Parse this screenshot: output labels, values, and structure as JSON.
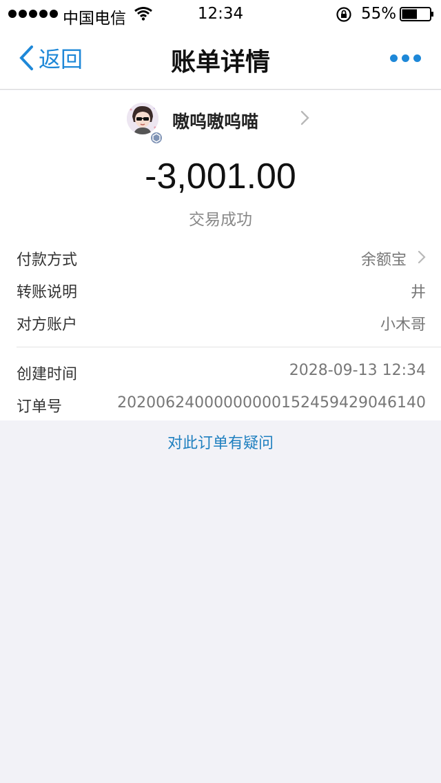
{
  "status_bar": {
    "carrier": "中国电信",
    "time": "12:34",
    "battery_percent": "55%",
    "battery_level": 0.55
  },
  "nav": {
    "back_label": "返回",
    "title": "账单详情"
  },
  "payee": {
    "name": "嗷呜嗷呜喵"
  },
  "transaction": {
    "amount": "-3,001.00",
    "status": "交易成功"
  },
  "details": [
    {
      "label": "付款方式",
      "value": "余额宝"
    },
    {
      "label": "转账说明",
      "value": "井"
    },
    {
      "label": "对方账户",
      "value": "小木哥"
    }
  ],
  "meta": [
    {
      "label": "创建时间",
      "value": "2028-09-13 12:34"
    },
    {
      "label": "订单号",
      "value": "20200624000000000152459429046140"
    }
  ],
  "question_link": "对此订单有疑问",
  "colors": {
    "accent": "#1e88d8",
    "background": "#f2f2f7"
  }
}
